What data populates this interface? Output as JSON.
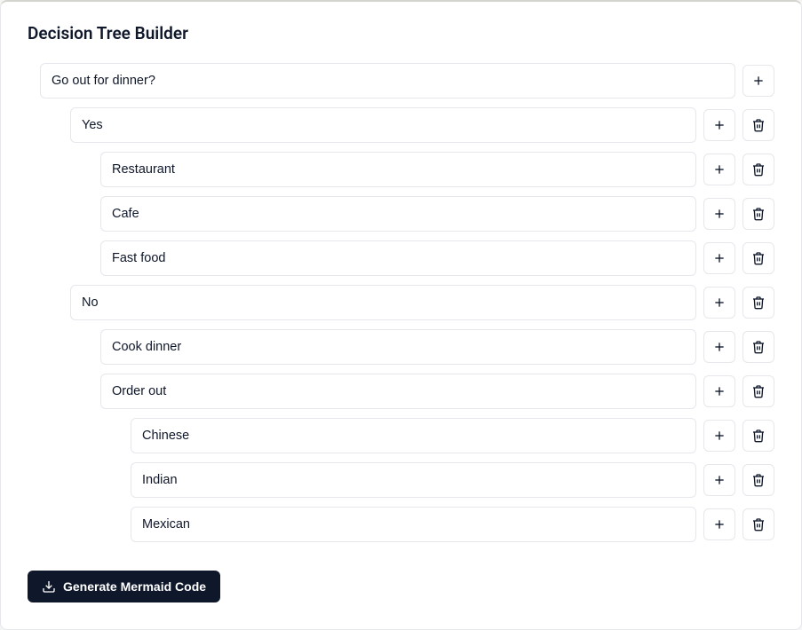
{
  "title": "Decision Tree Builder",
  "generate_label": "Generate Mermaid Code",
  "tree": {
    "label": "Go out for dinner?",
    "children": [
      {
        "label": "Yes",
        "children": [
          {
            "label": "Restaurant",
            "children": []
          },
          {
            "label": "Cafe",
            "children": []
          },
          {
            "label": "Fast food",
            "children": []
          }
        ]
      },
      {
        "label": "No",
        "children": [
          {
            "label": "Cook dinner",
            "children": []
          },
          {
            "label": "Order out",
            "children": [
              {
                "label": "Chinese",
                "children": []
              },
              {
                "label": "Indian",
                "children": []
              },
              {
                "label": "Mexican",
                "children": []
              }
            ]
          }
        ]
      }
    ]
  }
}
